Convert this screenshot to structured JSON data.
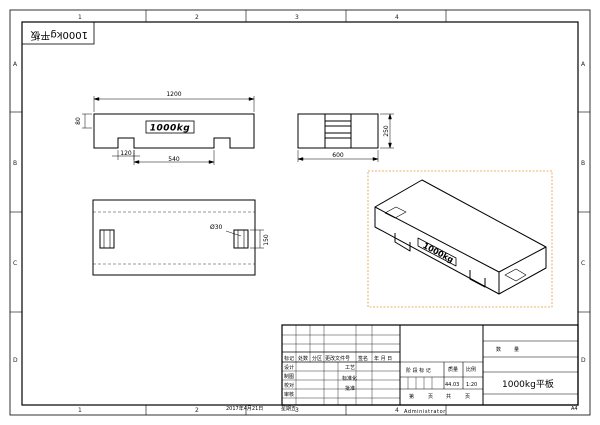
{
  "title_stamp": "1000kg平板",
  "zone_top": [
    "1",
    "2",
    "3",
    "4"
  ],
  "zone_bottom": [
    "1",
    "2",
    "3",
    "4"
  ],
  "zone_left": [
    "A",
    "B",
    "C",
    "D"
  ],
  "zone_right": [
    "A",
    "B",
    "C",
    "D"
  ],
  "front_view": {
    "dim_length": "1200",
    "dim_height": "80",
    "dim_notch": "120",
    "dim_span": "540",
    "plate_label": "1000kg"
  },
  "side_view": {
    "dim_width": "600",
    "dim_height": "250"
  },
  "top_view": {
    "dim_hole": "Ø30",
    "dim_slot": "150"
  },
  "iso_view": {
    "plate_label": "1000kg"
  },
  "title_block": {
    "rev_headers": [
      "标记",
      "处数",
      "分区",
      "更改文件号",
      "签名",
      "年 月 日"
    ],
    "roles": [
      "设计",
      "制图",
      "校对",
      "审核"
    ],
    "right_roles": [
      "工艺",
      "标准化",
      "批准"
    ],
    "stage_label": "阶 段 标 记",
    "mass_label": "质量",
    "scale_label": "比例",
    "mass_value": "44.03",
    "scale_value": "1:20",
    "sheet_labels": [
      "第",
      "页",
      "共",
      "页"
    ],
    "qty_label": "数",
    "qty_label2": "量",
    "part_name": "1000kg平板",
    "date": "2017年4月21日",
    "weekday": "星期五",
    "author": "Administrator",
    "sheet_size": "A4"
  }
}
